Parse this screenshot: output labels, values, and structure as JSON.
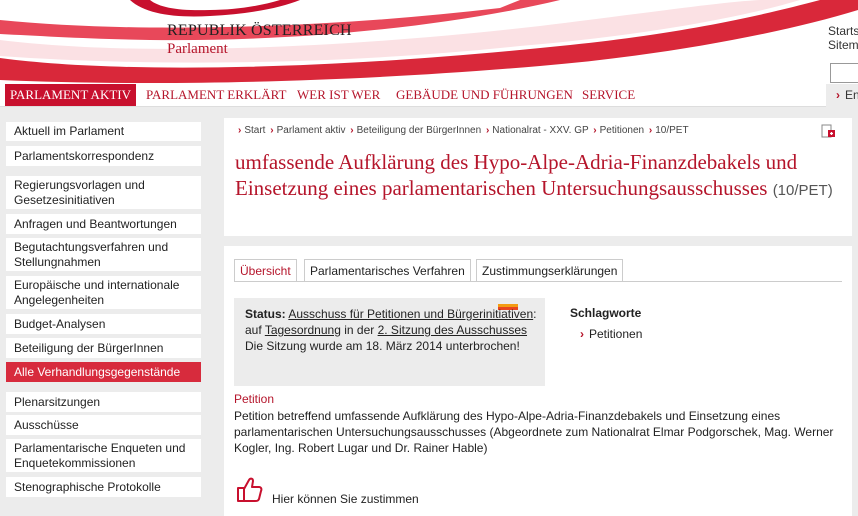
{
  "header": {
    "logo_title": "REPUBLIK ÖSTERREICH",
    "logo_subtitle": "Parlament",
    "start_link": "Startseite",
    "sitemap_link": "Sitemap",
    "search_value": "",
    "lang_link": "English"
  },
  "nav": [
    {
      "label": "PARLAMENT AKTIV",
      "active": true
    },
    {
      "label": "PARLAMENT ERKLÄRT"
    },
    {
      "label": "WER IST WER"
    },
    {
      "label": "GEBÄUDE UND FÜHRUNGEN"
    },
    {
      "label": "SERVICE"
    }
  ],
  "sidebar": [
    {
      "label": "Aktuell im Parlament"
    },
    {
      "label": "Parlamentskorrespondenz"
    },
    {
      "label": "Regierungsvorlagen und Gesetzesinitiativen"
    },
    {
      "label": "Anfragen und Beantwortungen"
    },
    {
      "label": "Begutachtungsverfahren und Stellungnahmen"
    },
    {
      "label": "Europäische und internationale Angelegenheiten"
    },
    {
      "label": "Budget-Analysen"
    },
    {
      "label": "Beteiligung der BürgerInnen"
    },
    {
      "label": "Alle Verhandlungsgegenstände",
      "active": true
    },
    {
      "label": "Plenarsitzungen"
    },
    {
      "label": "Ausschüsse"
    },
    {
      "label": "Parlamentarische Enqueten und Enquetekommissionen"
    },
    {
      "label": "Stenographische Protokolle"
    }
  ],
  "breadcrumb": [
    "Start",
    "Parlament aktiv",
    "Beteiligung der BürgerInnen",
    "Nationalrat - XXV. GP",
    "Petitionen",
    "10/PET"
  ],
  "title": {
    "text": "umfassende Aufklärung des Hypo-Alpe-Adria-Finanzdebakels und Einsetzung eines parlamentarischen Untersuchungsausschusses",
    "code": "(10/PET)"
  },
  "tabs": [
    {
      "label": "Übersicht",
      "active": true
    },
    {
      "label": "Parlamentarisches Verfahren"
    },
    {
      "label": "Zustimmungserklärungen"
    }
  ],
  "status": {
    "label": "Status:",
    "committee_link": "Ausschuss für Petitionen und Bürgerinitiativen",
    "colon": ":",
    "on": "auf",
    "agenda_link": "Tagesordnung",
    "in_der": "in der",
    "session_link": "2. Sitzung des Ausschusses",
    "note": "Die Sitzung wurde am 18. März 2014 unterbrochen!",
    "bar_colors": [
      "#f39c12",
      "#e8451e"
    ]
  },
  "keywords": {
    "title": "Schlagworte",
    "items": [
      "Petitionen"
    ]
  },
  "petition": {
    "label": "Petition",
    "text": "Petition betreffend umfassende Aufklärung des Hypo-Alpe-Adria-Finanzdebakels und Einsetzung eines parlamentarischen Untersuchungsausschusses (Abgeordnete zum Nationalrat Elmar Podgorschek, Mag. Werner Kogler, Ing. Robert Lugar und Dr. Rainer Hable)"
  },
  "zustimmen": {
    "label": "Hier können Sie zustimmen",
    "icon": "thumbs-up-icon"
  },
  "colors": {
    "brand_red": "#b5152b",
    "active_red": "#c8102e"
  }
}
